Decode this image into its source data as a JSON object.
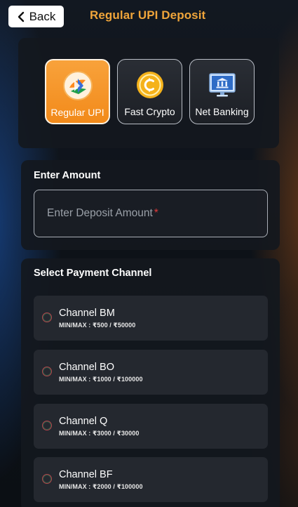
{
  "header": {
    "back_label": "Back",
    "title": "Regular UPI Deposit"
  },
  "methods": [
    {
      "label": "Regular UPI",
      "icon": "upi-logo-icon",
      "active": true
    },
    {
      "label": "Fast Crypto",
      "icon": "crypto-coin-icon",
      "active": false
    },
    {
      "label": "Net Banking",
      "icon": "bank-monitor-icon",
      "active": false
    }
  ],
  "amount": {
    "section_title": "Enter Amount",
    "placeholder": "Enter Deposit Amount",
    "required_marker": "*"
  },
  "channels": {
    "section_title": "Select Payment Channel",
    "items": [
      {
        "name": "Channel BM",
        "range": "MIN/MAX : ₹500 / ₹50000"
      },
      {
        "name": "Channel BO",
        "range": "MIN/MAX : ₹1000 / ₹100000"
      },
      {
        "name": "Channel Q",
        "range": "MIN/MAX : ₹3000 / ₹30000"
      },
      {
        "name": "Channel BF",
        "range": "MIN/MAX : ₹2000 / ₹100000"
      }
    ]
  },
  "colors": {
    "accent": "#f0a53a",
    "active_tab": "#f59a2c",
    "background": "#0c1117"
  }
}
